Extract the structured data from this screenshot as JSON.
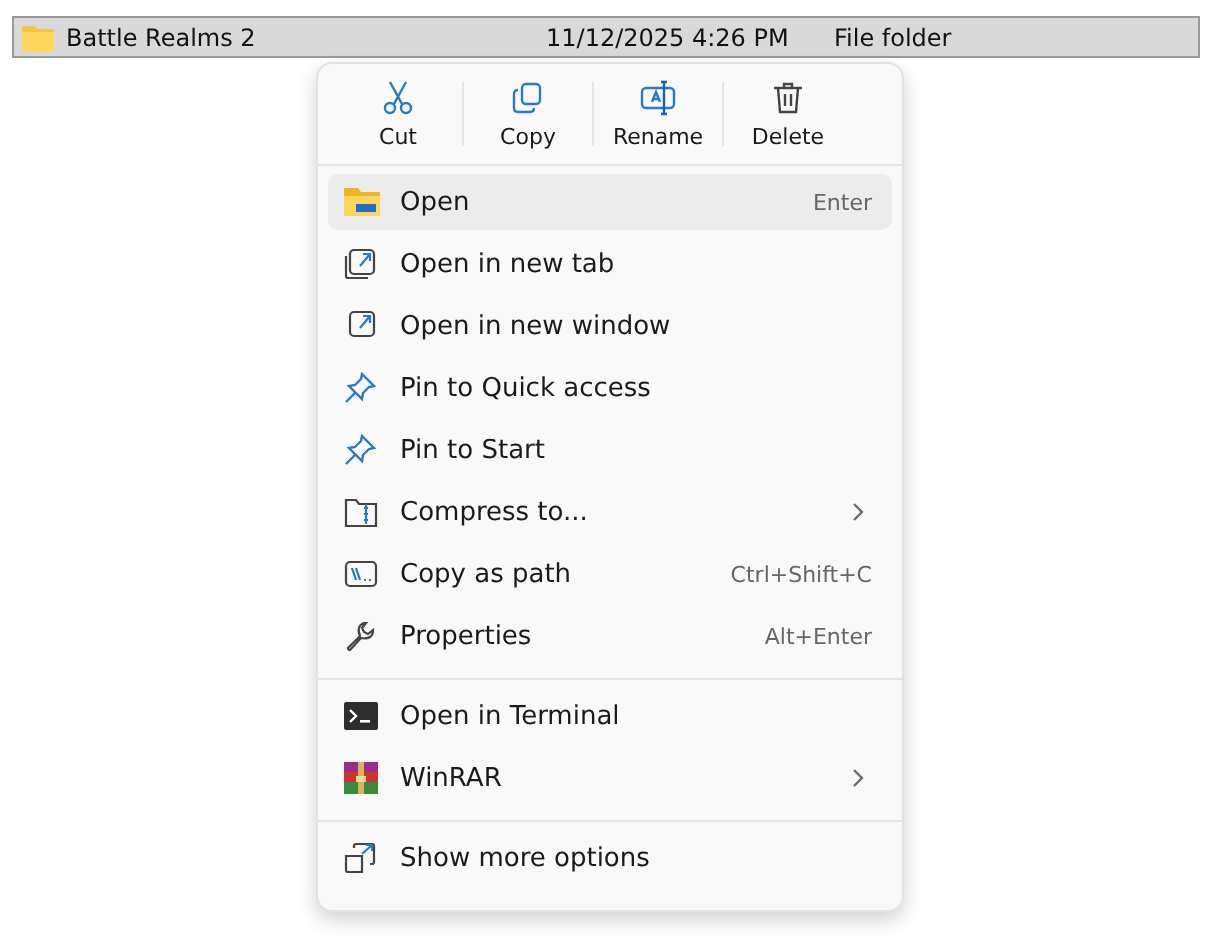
{
  "file_row": {
    "name": "Battle Realms 2",
    "date": "11/12/2025 4:26 PM",
    "type": "File folder",
    "selected": true
  },
  "context_menu": {
    "actions": [
      {
        "label": "Cut"
      },
      {
        "label": "Copy"
      },
      {
        "label": "Rename"
      },
      {
        "label": "Delete"
      }
    ],
    "sections": [
      [
        {
          "label": "Open",
          "shortcut": "Enter",
          "selected": true,
          "submenu": false
        },
        {
          "label": "Open in new tab",
          "selected": false,
          "submenu": false
        },
        {
          "label": "Open in new window",
          "selected": false,
          "submenu": false
        },
        {
          "label": "Pin to Quick access",
          "selected": false,
          "submenu": false
        },
        {
          "label": "Pin to Start",
          "selected": false,
          "submenu": false
        },
        {
          "label": "Compress to...",
          "selected": false,
          "submenu": true
        },
        {
          "label": "Copy as path",
          "shortcut": "Ctrl+Shift+C",
          "selected": false,
          "submenu": false
        },
        {
          "label": "Properties",
          "shortcut": "Alt+Enter",
          "selected": false,
          "submenu": false
        }
      ],
      [
        {
          "label": "Open in Terminal",
          "selected": false,
          "submenu": false
        },
        {
          "label": "WinRAR",
          "selected": false,
          "submenu": true
        }
      ],
      [
        {
          "label": "Show more options",
          "selected": false,
          "submenu": false
        }
      ]
    ]
  }
}
